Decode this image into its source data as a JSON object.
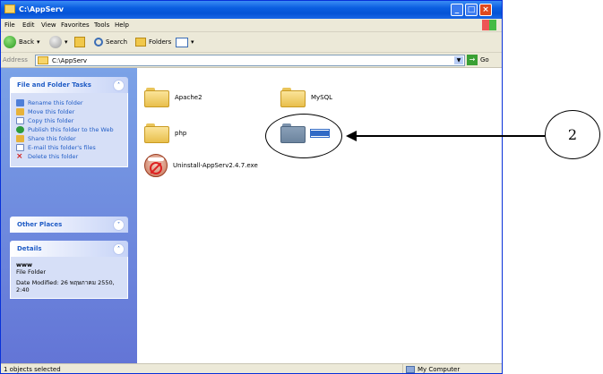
{
  "window": {
    "title": "C:\\AppServ"
  },
  "menu": [
    "File",
    "Edit",
    "View",
    "Favorites",
    "Tools",
    "Help"
  ],
  "toolbar": {
    "back": "Back",
    "search": "Search",
    "folders": "Folders"
  },
  "address": {
    "label": "Address",
    "value": "C:\\AppServ",
    "go": "Go"
  },
  "tasks": {
    "title": "File and Folder Tasks",
    "items": [
      "Rename this folder",
      "Move this folder",
      "Copy this folder",
      "Publish this folder to the Web",
      "Share this folder",
      "E-mail this folder's files",
      "Delete this folder"
    ]
  },
  "other_places": {
    "title": "Other Places"
  },
  "details": {
    "title": "Details",
    "name": "www",
    "type": "File Folder",
    "modified": "Date Modified: 26 พฤษภาคม 2550, 2:40"
  },
  "files": [
    {
      "name": "Apache2",
      "kind": "folder"
    },
    {
      "name": "MySQL",
      "kind": "folder"
    },
    {
      "name": "php",
      "kind": "folder"
    },
    {
      "name": "www",
      "kind": "folder",
      "selected": true
    },
    {
      "name": "Uninstall-AppServ2.4.7.exe",
      "kind": "exe"
    }
  ],
  "status": {
    "left": "1 objects selected",
    "right": "My Computer"
  },
  "annotation": {
    "label": "2"
  }
}
